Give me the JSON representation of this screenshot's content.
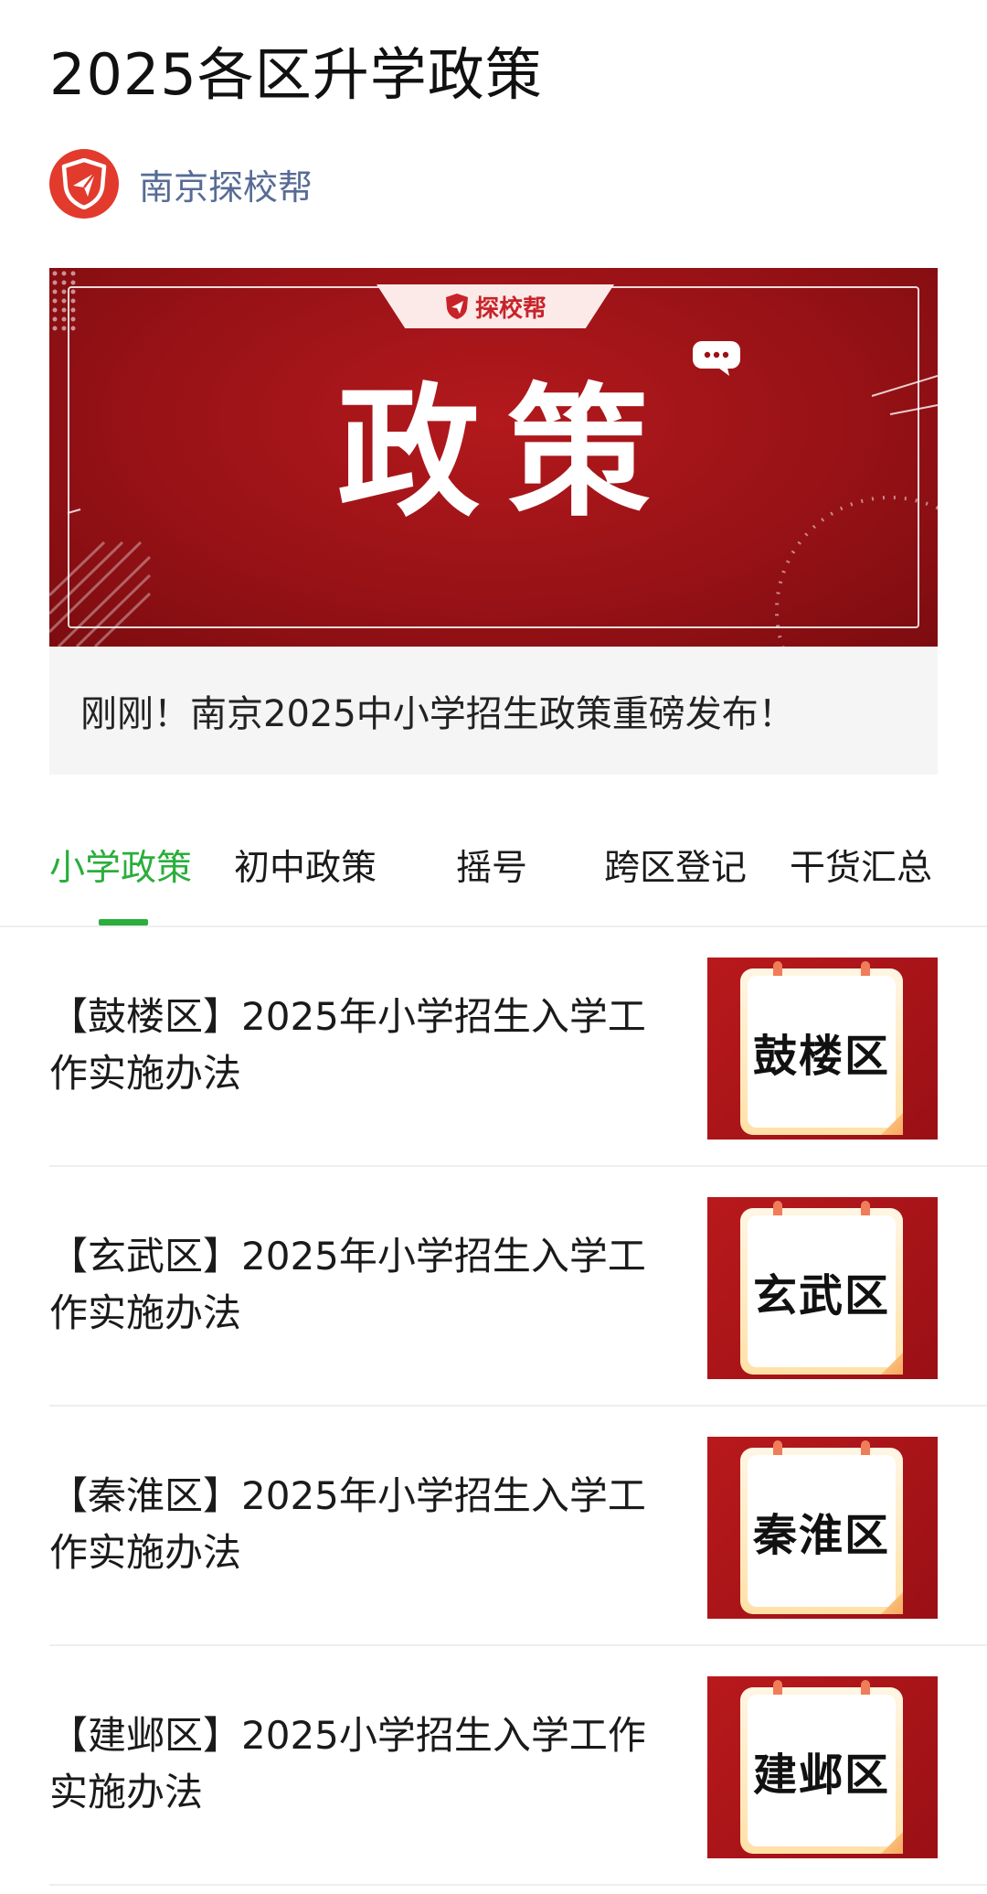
{
  "page": {
    "title": "2025各区升学政策"
  },
  "author": {
    "name": "南京探校帮",
    "avatar_icon": "paper-plane-shield-icon"
  },
  "banner": {
    "tab_label": "探校帮",
    "title": "政策",
    "caption": "刚刚！南京2025中小学招生政策重磅发布！",
    "colors": {
      "background": "#a51419",
      "tab_text": "#c8232a"
    }
  },
  "tabs": {
    "active_color": "#2aae3c",
    "items": [
      {
        "label": "小学政策",
        "active": true
      },
      {
        "label": "初中政策",
        "active": false
      },
      {
        "label": "摇号",
        "active": false
      },
      {
        "label": "跨区登记",
        "active": false
      },
      {
        "label": "干货汇总",
        "active": false
      }
    ]
  },
  "articles": [
    {
      "title": "【鼓楼区】2025年小学招生入学工作实施办法",
      "thumb_label": "鼓楼区"
    },
    {
      "title": "【玄武区】2025年小学招生入学工作实施办法",
      "thumb_label": "玄武区"
    },
    {
      "title": "【秦淮区】2025年小学招生入学工作实施办法",
      "thumb_label": "秦淮区"
    },
    {
      "title": "【建邺区】2025小学招生入学工作实施办法",
      "thumb_label": "建邺区"
    }
  ]
}
